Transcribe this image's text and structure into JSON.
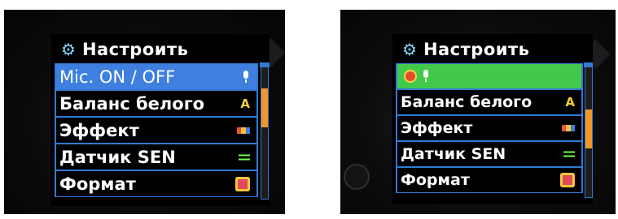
{
  "panels": [
    {
      "title": "Настроить",
      "items": [
        {
          "label": "Mic. ON / OFF",
          "icon": "microphone-icon",
          "selected": true
        },
        {
          "label": "Баланс белого",
          "icon": "white-balance-icon",
          "selected": false
        },
        {
          "label": "Эффект",
          "icon": "effect-icon",
          "selected": false
        },
        {
          "label": "Датчик SEN",
          "icon": "sensor-icon",
          "selected": false
        },
        {
          "label": "Формат",
          "icon": "format-icon",
          "selected": false
        }
      ]
    },
    {
      "title": "Настроить",
      "items": [
        {
          "label": "",
          "icon": "mic-off-and-on-icons",
          "selected": true
        },
        {
          "label": "Баланс белого",
          "icon": "white-balance-icon",
          "selected": false
        },
        {
          "label": "Эффект",
          "icon": "effect-icon",
          "selected": false
        },
        {
          "label": "Датчик SEN",
          "icon": "sensor-icon",
          "selected": false
        },
        {
          "label": "Формат",
          "icon": "format-icon",
          "selected": false
        }
      ]
    }
  ],
  "colors": {
    "menu_border": "#2f7bd6",
    "selected_blue": "#3f7fe0",
    "selected_green": "#43c94a",
    "scroll_thumb": "#f0962a"
  }
}
